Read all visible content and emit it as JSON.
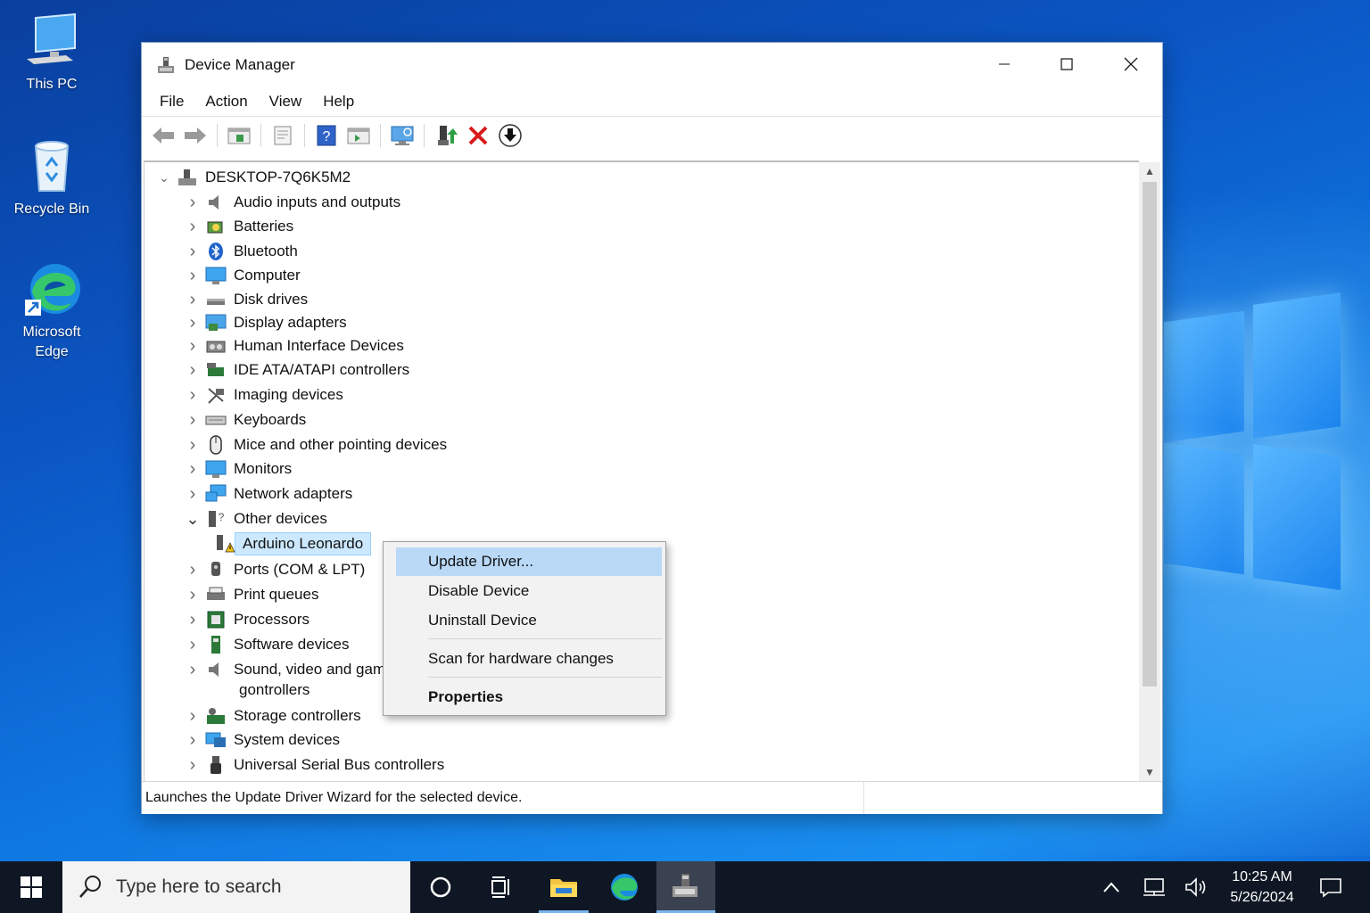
{
  "desktop": {
    "icons": [
      {
        "label": "This PC"
      },
      {
        "label": "Recycle Bin"
      },
      {
        "label": "Microsoft Edge"
      }
    ]
  },
  "window": {
    "title": "Device Manager",
    "menu": [
      "File",
      "Action",
      "View",
      "Help"
    ],
    "toolbar_icons": [
      "back-arrow-icon",
      "forward-arrow-icon",
      "show-hide-console-tree-icon",
      "properties-icon",
      "help-icon",
      "action-pane-icon",
      "scan-hardware-icon",
      "update-driver-icon",
      "uninstall-device-icon",
      "enable-device-icon"
    ],
    "tree": {
      "root": "DESKTOP-7Q6K5M2",
      "categories": [
        {
          "label": "Audio inputs and outputs",
          "icon": "speaker-icon"
        },
        {
          "label": "Batteries",
          "icon": "battery-icon"
        },
        {
          "label": "Bluetooth",
          "icon": "bluetooth-icon"
        },
        {
          "label": "Computer",
          "icon": "monitor-icon"
        },
        {
          "label": "Disk drives",
          "icon": "disk-drive-icon"
        },
        {
          "label": "Display adapters",
          "icon": "display-adapter-icon"
        },
        {
          "label": "Human Interface Devices",
          "icon": "hid-icon"
        },
        {
          "label": "IDE ATA/ATAPI controllers",
          "icon": "ide-controller-icon"
        },
        {
          "label": "Imaging devices",
          "icon": "camera-icon"
        },
        {
          "label": "Keyboards",
          "icon": "keyboard-icon"
        },
        {
          "label": "Mice and other pointing devices",
          "icon": "mouse-icon"
        },
        {
          "label": "Monitors",
          "icon": "monitor-icon"
        },
        {
          "label": "Network adapters",
          "icon": "network-adapter-icon"
        },
        {
          "label": "Other devices",
          "icon": "unknown-device-icon",
          "expanded": true
        },
        {
          "label": "Arduino Leonardo",
          "icon": "warning-device-icon",
          "child": true,
          "selected": true
        },
        {
          "label": "Ports (COM & LPT)",
          "icon": "port-icon"
        },
        {
          "label": "Print queues",
          "icon": "printer-icon"
        },
        {
          "label": "Processors",
          "icon": "processor-icon"
        },
        {
          "label": "Software devices",
          "icon": "software-device-icon"
        },
        {
          "label": "Sound, video and gam",
          "icon": "speaker-icon"
        },
        {
          "label": "gontrollers",
          "icon": "",
          "continuation": true
        },
        {
          "label": "Storage controllers",
          "icon": "storage-controller-icon"
        },
        {
          "label": "System devices",
          "icon": "system-device-icon"
        },
        {
          "label": "Universal Serial Bus controllers",
          "icon": "usb-icon"
        }
      ]
    },
    "context_menu": {
      "items": [
        "Update Driver...",
        "Disable Device",
        "Uninstall Device",
        "Scan for hardware changes",
        "Properties"
      ]
    },
    "status": "Launches the Update Driver Wizard for the selected device."
  },
  "taskbar": {
    "search_placeholder": "Type here to search",
    "time": "10:25 AM",
    "date": "5/26/2024"
  },
  "colors": {
    "selection": "#cce8ff",
    "menu_hover": "#b9d9f7",
    "taskbar": "#101724"
  }
}
